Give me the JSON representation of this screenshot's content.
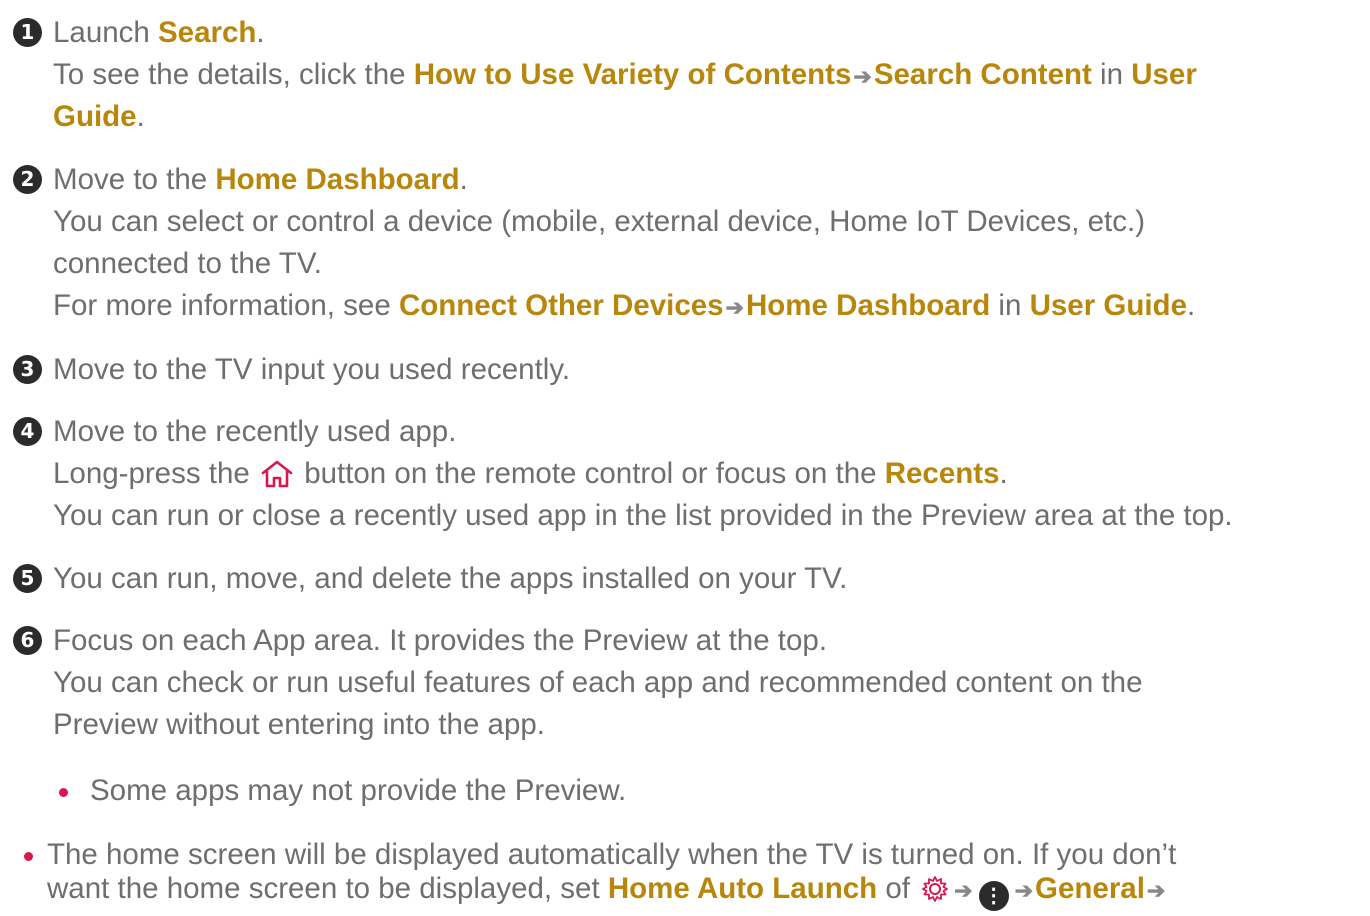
{
  "steps": [
    {
      "number": "1",
      "line1": {
        "t1": "Launch ",
        "h1": "Search",
        "t2": "."
      },
      "line2": {
        "t1": "To see the details, click the ",
        "h1": "How to Use Variety of Contents",
        "h2": "Search Content",
        "t2": " in ",
        "h3": "User"
      },
      "line3": {
        "h1": "Guide",
        "t1": "."
      }
    },
    {
      "number": "2",
      "line1": {
        "t1": "Move to the ",
        "h1": "Home Dashboard",
        "t2": "."
      },
      "line2": "You can select or control a device (mobile, external device, Home IoT Devices, etc.)",
      "line3": "connected to the TV.",
      "line4": {
        "t1": "For more information, see ",
        "h1": "Connect Other Devices",
        "h2": "Home Dashboard",
        "t2": " in ",
        "h3": "User Guide",
        "t3": "."
      }
    },
    {
      "number": "3",
      "line1": "Move to the TV input you used recently."
    },
    {
      "number": "4",
      "line1": "Move to the recently used app.",
      "line2": {
        "t1": "Long-press the ",
        "t2": " button on the remote control or focus on the ",
        "h1": "Recents",
        "t3": "."
      },
      "line3": "You can run or close a recently used app in the list provided in the Preview area at the top."
    },
    {
      "number": "5",
      "line1": "You can run, move, and delete the apps installed on your TV."
    },
    {
      "number": "6",
      "line1": "Focus on each App area. It provides the Preview at the top.",
      "line2": "You can check or run useful features of each app and recommended content on the",
      "line3": "Preview without entering into the app."
    }
  ],
  "sub_bullet": "Some apps may not provide the Preview.",
  "note": {
    "line1": "The home screen will be displayed automatically when the TV is turned on. If you don’t",
    "line2": {
      "t1": "want the home screen to be displayed, set ",
      "h1": "Home Auto Launch",
      "t2": " of ",
      "h2": "General"
    }
  },
  "arrow_glyph": "➔",
  "menu_icon_glyph": "⋮",
  "colors": {
    "text": "#6e6e6e",
    "highlight": "#b8860b",
    "bullet": "#d9174f",
    "badge": "#2b2b2b"
  },
  "icons": [
    "home-icon",
    "gear-icon",
    "more-menu-icon",
    "arrow-right-icon"
  ]
}
